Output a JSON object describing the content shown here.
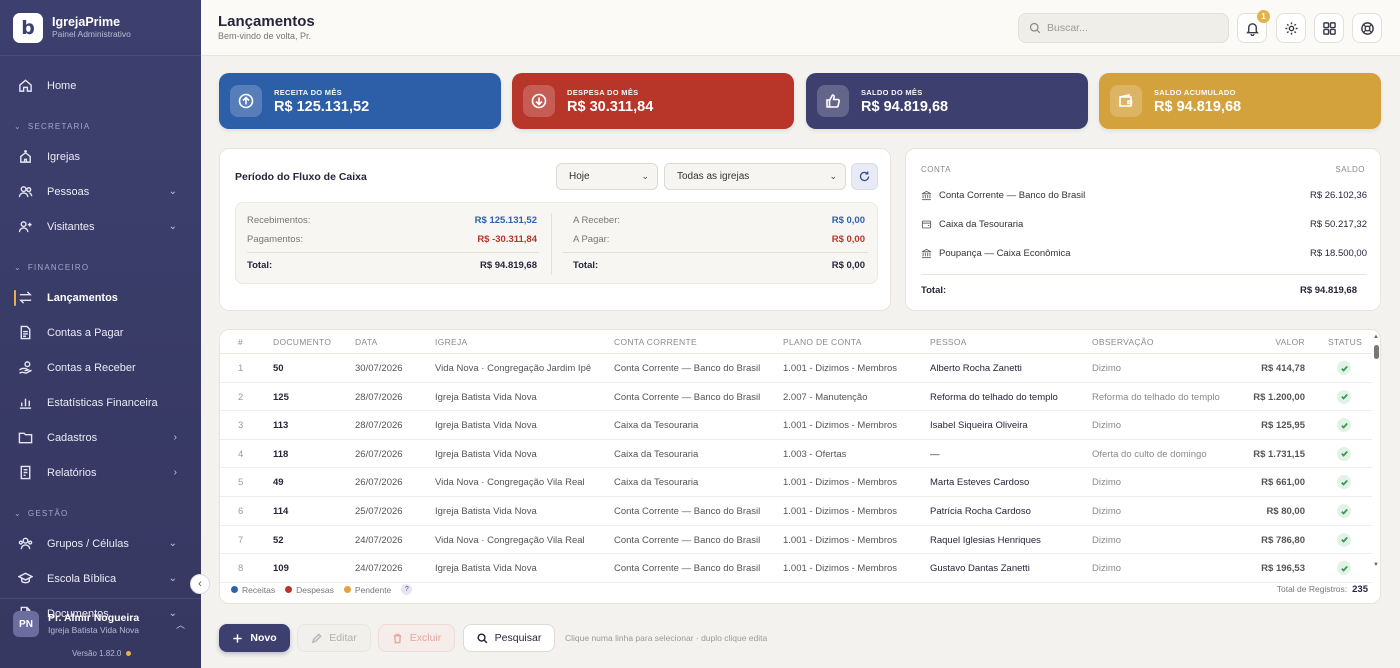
{
  "app": {
    "logo_letter": "b",
    "name": "IgrejaPrime",
    "subtitle": "Painel Administrativo"
  },
  "sidebar": {
    "items": [
      {
        "label": "Home",
        "icon": "home-icon"
      },
      {
        "section": "SECRETARIA"
      },
      {
        "label": "Igrejas",
        "icon": "church-icon"
      },
      {
        "label": "Pessoas",
        "icon": "users-icon",
        "expandable": true
      },
      {
        "label": "Visitantes",
        "icon": "user-plus-icon",
        "expandable": true
      },
      {
        "section": "FINANCEIRO"
      },
      {
        "label": "Lançamentos",
        "icon": "arrows-icon",
        "active": true
      },
      {
        "label": "Contas a Pagar",
        "icon": "document-icon"
      },
      {
        "label": "Contas a Receber",
        "icon": "hand-coins-icon"
      },
      {
        "label": "Estatísticas Financeira",
        "icon": "bar-chart-icon"
      },
      {
        "label": "Cadastros",
        "icon": "folder-icon",
        "submenu": true
      },
      {
        "label": "Relatórios",
        "icon": "report-icon",
        "submenu": true
      },
      {
        "section": "GESTÃO"
      },
      {
        "label": "Grupos / Células",
        "icon": "group-icon",
        "expandable": true
      },
      {
        "label": "Escola Bíblica",
        "icon": "school-icon",
        "expandable": true
      },
      {
        "label": "Documentos",
        "icon": "file-icon",
        "expandable": true
      }
    ],
    "user": {
      "initials": "PN",
      "name": "Pr. Almir Nogueira",
      "church": "Igreja Batista Vida Nova"
    },
    "version": "Versão 1.82.0"
  },
  "header": {
    "title": "Lançamentos",
    "subtitle": "Bem-vindo de volta, Pr.",
    "search_placeholder": "Buscar...",
    "notification_count": "1"
  },
  "summary": [
    {
      "label": "RECEITA DO MÊS",
      "value": "R$ 125.131,52",
      "color": "#2d5ea8",
      "icon": "arrow-up-circle-icon"
    },
    {
      "label": "DESPESA DO MÊS",
      "value": "R$ 30.311,84",
      "color": "#b8352a",
      "icon": "arrow-down-circle-icon"
    },
    {
      "label": "SALDO DO MÊS",
      "value": "R$ 94.819,68",
      "color": "#3d3f6e",
      "icon": "thumbs-up-icon"
    },
    {
      "label": "SALDO ACUMULADO",
      "value": "R$ 94.819,68",
      "color": "#d4a23d",
      "icon": "wallet-icon"
    }
  ],
  "cashflow": {
    "title": "Período do Fluxo de Caixa",
    "period": "Hoje",
    "church_filter": "Todas as igrejas",
    "left": [
      {
        "label": "Recebimentos:",
        "value": "R$ 125.131,52",
        "tone": "blue"
      },
      {
        "label": "Pagamentos:",
        "value": "R$ -30.311,84",
        "tone": "red"
      },
      {
        "label": "Total:",
        "value": "R$ 94.819,68",
        "tone": "dark"
      }
    ],
    "right": [
      {
        "label": "A Receber:",
        "value": "R$ 0,00",
        "tone": "blue"
      },
      {
        "label": "A Pagar:",
        "value": "R$ 0,00",
        "tone": "red"
      },
      {
        "label": "Total:",
        "value": "R$ 0,00",
        "tone": "dark"
      }
    ]
  },
  "accounts": {
    "col_account": "CONTA",
    "col_balance": "SALDO",
    "rows": [
      {
        "name": "Conta Corrente — Banco do Brasil",
        "value": "R$ 26.102,36",
        "icon": "bank-icon"
      },
      {
        "name": "Caixa da Tesouraria",
        "value": "R$ 50.217,32",
        "icon": "cash-box-icon"
      },
      {
        "name": "Poupança — Caixa Econômica",
        "value": "R$ 18.500,00",
        "icon": "bank-icon"
      }
    ],
    "total_label": "Total:",
    "total_value": "R$ 94.819,68"
  },
  "table": {
    "columns": [
      "#",
      "DOCUMENTO",
      "DATA",
      "IGREJA",
      "CONTA CORRENTE",
      "PLANO DE CONTA",
      "PESSOA",
      "OBSERVAÇÃO",
      "VALOR",
      "STATUS"
    ],
    "rows": [
      {
        "idx": "1",
        "doc": "50",
        "date": "30/07/2026",
        "church": "Vida Nova · Congregação Jardim Ipê",
        "account": "Conta Corrente — Banco do Brasil",
        "plan": "1.001 - Dizimos - Membros",
        "person": "Alberto Rocha Zanetti",
        "obs": "Dizimo",
        "value": "R$ 414,78",
        "tone": "blue"
      },
      {
        "idx": "2",
        "doc": "125",
        "date": "28/07/2026",
        "church": "Igreja Batista Vida Nova",
        "account": "Conta Corrente — Banco do Brasil",
        "plan": "2.007 - Manutenção",
        "person": "Reforma do telhado do templo",
        "obs": "Reforma do telhado do templo",
        "value": "R$ 1.200,00",
        "tone": "red"
      },
      {
        "idx": "3",
        "doc": "113",
        "date": "28/07/2026",
        "church": "Igreja Batista Vida Nova",
        "account": "Caixa da Tesouraria",
        "plan": "1.001 - Dizimos - Membros",
        "person": "Isabel Siqueira Oliveira",
        "obs": "Dizimo",
        "value": "R$ 125,95",
        "tone": "blue"
      },
      {
        "idx": "4",
        "doc": "118",
        "date": "26/07/2026",
        "church": "Igreja Batista Vida Nova",
        "account": "Caixa da Tesouraria",
        "plan": "1.003 - Ofertas",
        "person": "—",
        "obs": "Oferta do culto de domingo",
        "value": "R$ 1.731,15",
        "tone": "blue"
      },
      {
        "idx": "5",
        "doc": "49",
        "date": "26/07/2026",
        "church": "Vida Nova · Congregação Vila Real",
        "account": "Caixa da Tesouraria",
        "plan": "1.001 - Dizimos - Membros",
        "person": "Marta Esteves Cardoso",
        "obs": "Dizimo",
        "value": "R$ 661,00",
        "tone": "blue"
      },
      {
        "idx": "6",
        "doc": "114",
        "date": "25/07/2026",
        "church": "Igreja Batista Vida Nova",
        "account": "Conta Corrente — Banco do Brasil",
        "plan": "1.001 - Dizimos - Membros",
        "person": "Patrícia Rocha Cardoso",
        "obs": "Dizimo",
        "value": "R$ 80,00",
        "tone": "blue"
      },
      {
        "idx": "7",
        "doc": "52",
        "date": "24/07/2026",
        "church": "Vida Nova · Congregação Vila Real",
        "account": "Conta Corrente — Banco do Brasil",
        "plan": "1.001 - Dizimos - Membros",
        "person": "Raquel Iglesias Henriques",
        "obs": "Dizimo",
        "value": "R$ 786,80",
        "tone": "blue"
      },
      {
        "idx": "8",
        "doc": "109",
        "date": "24/07/2026",
        "church": "Igreja Batista Vida Nova",
        "account": "Conta Corrente — Banco do Brasil",
        "plan": "1.001 - Dizimos - Membros",
        "person": "Gustavo Dantas Zanetti",
        "obs": "Dizimo",
        "value": "R$ 196,53",
        "tone": "blue"
      }
    ],
    "legend": [
      {
        "label": "Receitas",
        "color": "#2e61ad"
      },
      {
        "label": "Despesas",
        "color": "#b8352a"
      },
      {
        "label": "Pendente",
        "color": "#e3a23a"
      }
    ],
    "help_mark": "?",
    "total_label": "Total de Registros:",
    "total_value": "235"
  },
  "actions": {
    "new": "Novo",
    "edit": "Editar",
    "delete": "Excluir",
    "search": "Pesquisar",
    "hint": "Clique numa linha para selecionar · duplo clique edita"
  }
}
